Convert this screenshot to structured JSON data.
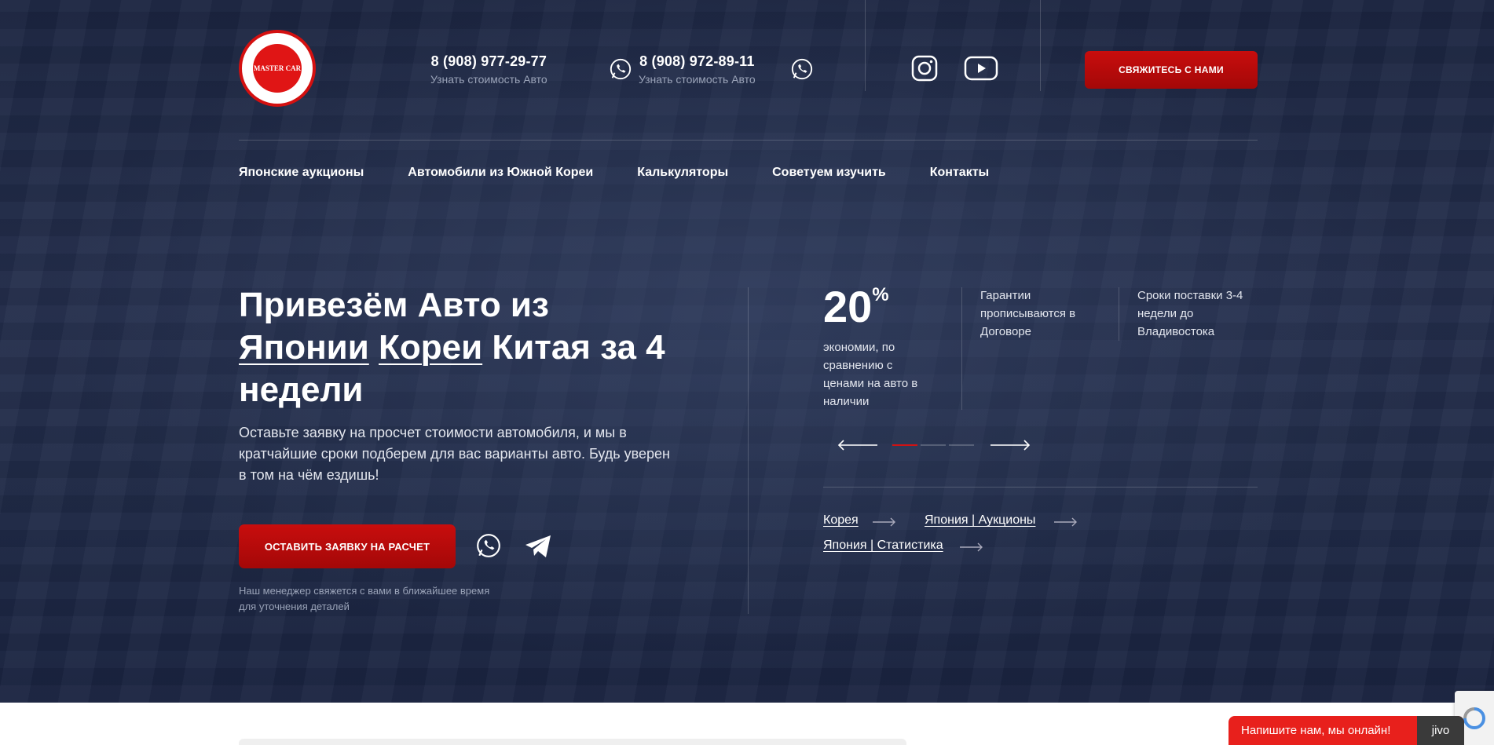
{
  "header": {
    "logo_text": "MASTER CAR",
    "phones": [
      {
        "number": "8 (908) 977-29-77",
        "caption": "Узнать стоимость Авто"
      },
      {
        "number": "8 (908) 972-89-11",
        "caption": "Узнать стоимость Авто"
      }
    ],
    "contact_button": "СВЯЖИТЕСЬ С НАМИ"
  },
  "nav": {
    "items": [
      "Японские аукционы",
      "Автомобили из Южной Кореи",
      "Калькуляторы",
      "Советуем изучить",
      "Контакты"
    ]
  },
  "hero": {
    "title_part1": "Привезём Авто из",
    "title_link1": "Японии",
    "title_link2": "Кореи",
    "title_part2": "Китая за 4",
    "title_part3": "недели",
    "lead": "Оставьте заявку на просчет стоимости автомобиля, и мы в кратчайшие сроки подберем для вас варианты авто. Будь уверен в том на чём ездишь!",
    "order_button": "ОСТАВИТЬ ЗАЯВКУ НА РАСЧЕТ",
    "note": "Наш менеджер свяжется с вами в ближайшее время для уточнения деталей"
  },
  "stats": {
    "big_number": "20",
    "big_unit": "%",
    "items": [
      "экономии, по сравнению с ценами на авто в наличии",
      "Гарантии прописываются в Договоре",
      "Сроки поставки 3-4 недели до Владивостока"
    ]
  },
  "links": [
    "Корея",
    "Япония | Аукционы",
    "Япония | Статистика"
  ],
  "jivo": {
    "label": "Напишите нам, мы онлайн!",
    "brand": "jivo"
  },
  "colors": {
    "accent": "#c80d0d",
    "hero_bg": "#1f2946"
  }
}
